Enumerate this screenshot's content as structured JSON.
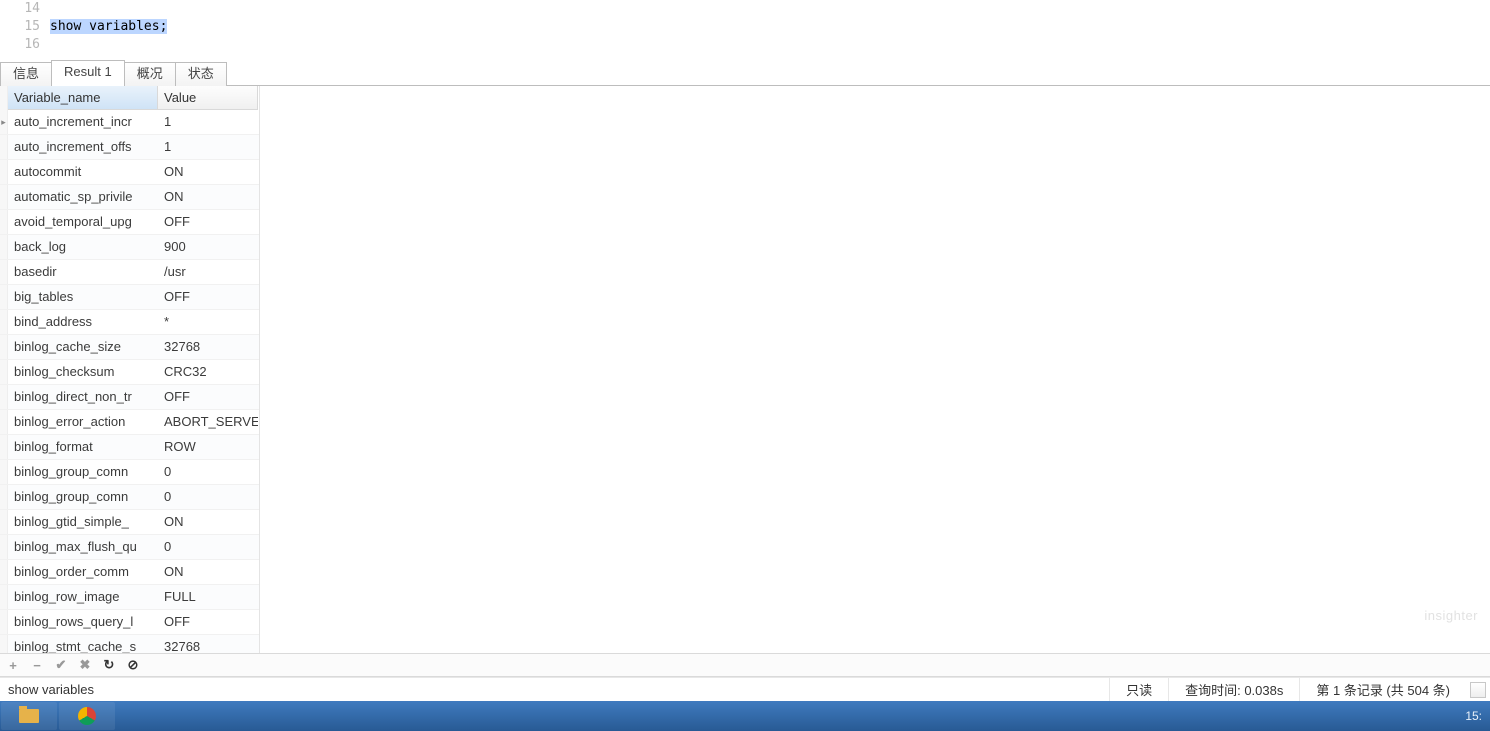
{
  "editor": {
    "lines": [
      {
        "num": "14",
        "text": ""
      },
      {
        "num": "15",
        "text": "show variables;"
      },
      {
        "num": "16",
        "text": ""
      }
    ]
  },
  "tabs": {
    "items": [
      "信息",
      "Result 1",
      "概况",
      "状态"
    ],
    "active_index": 1
  },
  "grid": {
    "headers": {
      "name": "Variable_name",
      "value": "Value"
    },
    "rows": [
      {
        "name": "auto_increment_incr",
        "value": "1",
        "marker": "▸"
      },
      {
        "name": "auto_increment_offs",
        "value": "1",
        "marker": ""
      },
      {
        "name": "autocommit",
        "value": "ON",
        "marker": ""
      },
      {
        "name": "automatic_sp_privile",
        "value": "ON",
        "marker": ""
      },
      {
        "name": "avoid_temporal_upg",
        "value": "OFF",
        "marker": ""
      },
      {
        "name": "back_log",
        "value": "900",
        "marker": ""
      },
      {
        "name": "basedir",
        "value": "/usr",
        "marker": ""
      },
      {
        "name": "big_tables",
        "value": "OFF",
        "marker": ""
      },
      {
        "name": "bind_address",
        "value": "*",
        "marker": ""
      },
      {
        "name": "binlog_cache_size",
        "value": "32768",
        "marker": ""
      },
      {
        "name": "binlog_checksum",
        "value": "CRC32",
        "marker": ""
      },
      {
        "name": "binlog_direct_non_tr",
        "value": "OFF",
        "marker": ""
      },
      {
        "name": "binlog_error_action",
        "value": "ABORT_SERVE",
        "marker": ""
      },
      {
        "name": "binlog_format",
        "value": "ROW",
        "marker": ""
      },
      {
        "name": "binlog_group_comn",
        "value": "0",
        "marker": ""
      },
      {
        "name": "binlog_group_comn",
        "value": "0",
        "marker": ""
      },
      {
        "name": "binlog_gtid_simple_",
        "value": "ON",
        "marker": ""
      },
      {
        "name": "binlog_max_flush_qu",
        "value": "0",
        "marker": ""
      },
      {
        "name": "binlog_order_comm",
        "value": "ON",
        "marker": ""
      },
      {
        "name": "binlog_row_image",
        "value": "FULL",
        "marker": ""
      },
      {
        "name": "binlog_rows_query_l",
        "value": "OFF",
        "marker": ""
      },
      {
        "name": "binlog_stmt_cache_s",
        "value": "32768",
        "marker": ""
      }
    ]
  },
  "toolbar": {
    "add": "+",
    "remove": "−",
    "apply": "✔",
    "cancel": "✖",
    "refresh": "↻",
    "stop": "⊘"
  },
  "status": {
    "query": "show variables",
    "readonly": "只读",
    "time_label": "查询时间: 0.038s",
    "record_label": "第 1 条记录 (共 504 条)"
  },
  "watermark": "insighter",
  "taskbar": {
    "clock": "15:"
  }
}
